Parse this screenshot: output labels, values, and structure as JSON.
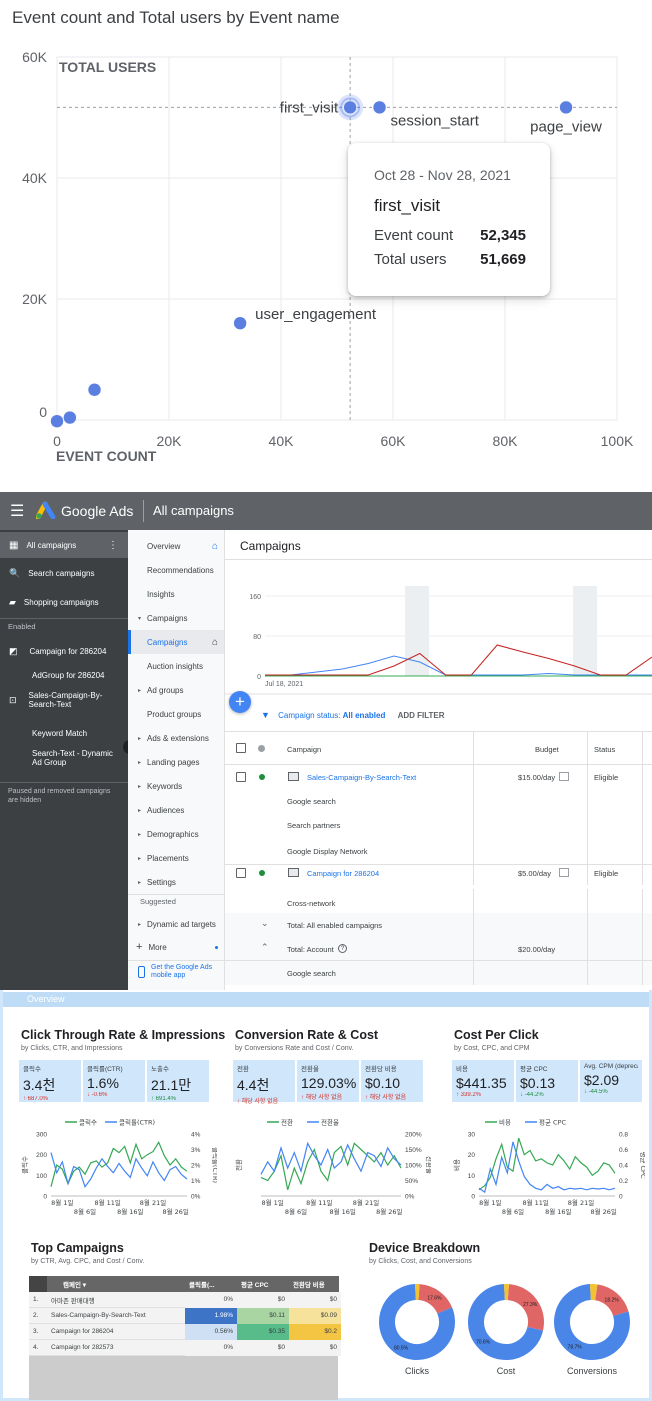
{
  "scatter": {
    "title": "Event count and Total users by Event name",
    "tooltip": {
      "date": "Oct 28 - Nov 28, 2021",
      "name": "first_visit",
      "event_count_label": "Event count",
      "event_count": "52,345",
      "total_users_label": "Total users",
      "total_users": "51,669"
    }
  },
  "chart_data": [
    {
      "type": "scatter",
      "title": "Event count and Total users by Event name",
      "xlabel": "EVENT COUNT",
      "ylabel": "TOTAL USERS",
      "xlim": [
        0,
        100000
      ],
      "ylim": [
        0,
        60000
      ],
      "x_ticks": [
        "0",
        "20K",
        "40K",
        "60K",
        "80K",
        "100K"
      ],
      "y_ticks": [
        "0",
        "20K",
        "40K",
        "60K"
      ],
      "points": [
        {
          "label": "first_visit",
          "x": 52345,
          "y": 51669
        },
        {
          "label": "session_start",
          "x": 57600,
          "y": 51669
        },
        {
          "label": "page_view",
          "x": 90900,
          "y": 51669
        },
        {
          "label": "user_engagement",
          "x": 32700,
          "y": 16000
        },
        {
          "label": "",
          "x": 6700,
          "y": 5000
        },
        {
          "label": "",
          "x": 2300,
          "y": 400
        },
        {
          "label": "",
          "x": 0,
          "y": -200
        }
      ],
      "grid": true
    },
    {
      "type": "line",
      "title": "",
      "y_ticks": [
        "0",
        "80",
        "160"
      ],
      "ylim": [
        0,
        160
      ],
      "x_start_label": "Jul 18, 2021",
      "series": [
        {
          "color": "#4285f4",
          "values": [
            2,
            2,
            8,
            14,
            25,
            40,
            28,
            2,
            2,
            2,
            2,
            5,
            2,
            2,
            2,
            2
          ]
        },
        {
          "color": "#c5221f",
          "values": [
            2,
            2,
            2,
            2,
            2,
            20,
            45,
            2,
            2,
            62,
            48,
            35,
            20,
            2,
            2,
            38
          ]
        },
        {
          "color": "#f9ab00",
          "values": [
            0,
            0,
            0,
            0,
            0,
            0,
            0,
            0,
            0,
            0,
            0,
            0,
            0,
            0,
            0,
            0
          ]
        },
        {
          "color": "#34a853",
          "values": [
            0,
            0,
            0,
            0,
            0,
            0,
            0,
            0,
            0,
            0,
            0,
            0,
            0,
            0,
            0,
            0
          ]
        }
      ]
    },
    {
      "type": "line",
      "title": "Click Through Rate & Impressions",
      "categories": [
        "8월 1일",
        "8월 6일",
        "8월 11일",
        "8월 16일",
        "8월 21일",
        "8월 26일"
      ],
      "left_ticks": [
        "0",
        "100",
        "200",
        "300"
      ],
      "right_ticks": [
        "0%",
        "1%",
        "2%",
        "3%",
        "4%"
      ],
      "ylabel_left": "클릭수",
      "ylabel_right": "클릭률(CTR)",
      "series": [
        {
          "name": "클릭수",
          "color": "#34a853",
          "values": [
            45,
            150,
            130,
            60,
            120,
            140,
            105,
            160,
            170,
            140,
            160,
            230,
            210,
            240,
            160,
            250,
            180,
            200,
            215,
            260,
            195,
            150,
            180,
            140,
            120
          ]
        },
        {
          "name": "클릭률(CTR)",
          "color": "#4285f4",
          "values": [
            2.8,
            1.5,
            2.2,
            0.8,
            1.9,
            1.7,
            0.6,
            1.1,
            1.8,
            2.4,
            1.9,
            1.5,
            2.1,
            1.6,
            1.2,
            2.4,
            1.8,
            1.3,
            2.2,
            1.5,
            1.0,
            1.7,
            1.9,
            1.4,
            1.1
          ]
        }
      ]
    },
    {
      "type": "line",
      "title": "Conversion Rate & Cost",
      "categories": [
        "8월 1일",
        "8월 6일",
        "8월 11일",
        "8월 16일",
        "8월 21일",
        "8월 26일"
      ],
      "right_ticks": [
        "0%",
        "50%",
        "100%",
        "150%",
        "200%"
      ],
      "ylabel_left": "전환",
      "ylabel_right": "전환율",
      "series": [
        {
          "name": "전환",
          "color": "#34a853",
          "values": [
            0.6,
            0.5,
            0.8,
            1.3,
            0.2,
            0.9,
            0.4,
            1.1,
            1.5,
            0.8,
            0.5,
            1.4,
            1.6,
            1.0,
            1.7,
            1.5,
            1.3,
            1.1,
            1.4,
            1.0,
            1.3,
            0.9
          ]
        },
        {
          "name": "전환율",
          "color": "#4285f4",
          "values": [
            70,
            110,
            80,
            155,
            90,
            140,
            80,
            170,
            130,
            100,
            150,
            90,
            110,
            165,
            120,
            80,
            140,
            130,
            95,
            155,
            120,
            100
          ]
        }
      ]
    },
    {
      "type": "line",
      "title": "Cost Per Click",
      "categories": [
        "8월 1일",
        "8월 6일",
        "8월 11일",
        "8월 16일",
        "8월 21일",
        "8월 26일"
      ],
      "left_ticks": [
        "0",
        "10",
        "20",
        "30"
      ],
      "right_ticks": [
        "0",
        "0.2",
        "0.4",
        "0.6",
        "0.8"
      ],
      "ylabel_left": "비용",
      "ylabel_right": "평균 CPC",
      "series": [
        {
          "name": "비용",
          "color": "#34a853",
          "values": [
            3,
            5,
            9,
            18,
            25,
            14,
            12,
            28,
            20,
            22,
            17,
            18,
            16,
            15,
            20,
            17,
            13,
            19,
            16,
            14,
            10,
            12,
            16,
            15,
            11
          ]
        },
        {
          "name": "평균 CPC",
          "color": "#4285f4",
          "values": [
            0.1,
            0.05,
            0.35,
            0.15,
            0.5,
            0.3,
            0.7,
            0.45,
            0.25,
            0.15,
            0.1,
            0.08,
            0.15,
            0.1,
            0.12,
            0.08,
            0.1,
            0.09,
            0.1,
            0.08,
            0.1,
            0.09,
            0.1,
            0.08,
            0.1
          ]
        }
      ]
    },
    {
      "type": "pie",
      "title": "Device Breakdown",
      "charts": [
        {
          "name": "Clicks",
          "slices": [
            {
              "value": 80.5,
              "color": "#4a86e8",
              "label": "80.5%"
            },
            {
              "value": 17.6,
              "color": "#e06666",
              "label": "17.6%"
            },
            {
              "value": 1.9,
              "color": "#f1c232",
              "label": ""
            }
          ]
        },
        {
          "name": "Cost",
          "slices": [
            {
              "value": 70.6,
              "color": "#4a86e8",
              "label": "70.6%"
            },
            {
              "value": 27.3,
              "color": "#e06666",
              "label": "27.3%"
            },
            {
              "value": 2.1,
              "color": "#f1c232",
              "label": ""
            }
          ]
        },
        {
          "name": "Conversions",
          "slices": [
            {
              "value": 78.7,
              "color": "#4a86e8",
              "label": "78.7%"
            },
            {
              "value": 18.2,
              "color": "#e06666",
              "label": "18.2%"
            },
            {
              "value": 3.1,
              "color": "#f1c232",
              "label": ""
            }
          ]
        }
      ]
    }
  ],
  "ads": {
    "brand": "Google Ads",
    "title": "All campaigns",
    "leftnav": [
      {
        "label": "All campaigns"
      },
      {
        "label": "Search campaigns"
      },
      {
        "label": "Shopping campaigns"
      },
      {
        "label": "Enabled"
      },
      {
        "label": "Campaign for 286204"
      },
      {
        "label": "AdGroup for 286204"
      },
      {
        "label": "Sales-Campaign-By-Search-Text"
      },
      {
        "label": "Keyword Match"
      },
      {
        "label": "Search-Text - Dynamic Ad Group"
      },
      {
        "label": "Paused and removed campaigns are hidden"
      }
    ],
    "midnav": [
      "Overview",
      "Recommendations",
      "Insights",
      "Campaigns",
      "Campaigns",
      "Auction insights",
      "Ad groups",
      "Product groups",
      "Ads & extensions",
      "Landing pages",
      "Keywords",
      "Audiences",
      "Demographics",
      "Placements",
      "Settings",
      "Suggested",
      "Dynamic ad targets",
      "More",
      "Get the Google Ads mobile app"
    ],
    "page_title": "Campaigns",
    "filter_label": "Campaign status:",
    "filter_value": "All enabled",
    "add_filter": "ADD FILTER",
    "columns": {
      "campaign": "Campaign",
      "budget": "Budget",
      "status": "Status"
    },
    "rows": [
      {
        "name": "Sales-Campaign-By-Search-Text",
        "budget": "$15.00/day",
        "status": "Eligible"
      },
      {
        "name": "Google search"
      },
      {
        "name": "Search partners"
      },
      {
        "name": "Google Display Network"
      },
      {
        "name": "Campaign for 286204",
        "budget": "$5.00/day",
        "status": "Eligible"
      },
      {
        "name": "Cross-network"
      },
      {
        "name": "Total: All enabled campaigns"
      },
      {
        "name": "Total: Account",
        "budget": "$20.00/day"
      },
      {
        "name": "Google search"
      }
    ]
  },
  "dash": {
    "overview": "Overview",
    "p1": {
      "title": "Click Through Rate & Impressions",
      "sub": "by Clicks, CTR, and Impressions",
      "kpis": [
        {
          "label": "클릭수",
          "value": "3.4천",
          "delta": "↑ 687.0%",
          "cls": "red"
        },
        {
          "label": "클릭률(CTR)",
          "value": "1.6%",
          "delta": "↓ -0.6%",
          "cls": "red"
        },
        {
          "label": "노출수",
          "value": "21.1만",
          "delta": "↑ 691.4%",
          "cls": "grn"
        }
      ]
    },
    "p2": {
      "title": "Conversion Rate & Cost",
      "sub": "by Conversions Rate and Cost / Conv.",
      "kpis": [
        {
          "label": "전환",
          "value": "4.4천",
          "delta": "↑ 해당 사항 없음",
          "cls": "red"
        },
        {
          "label": "전환율",
          "value": "129.03%",
          "delta": "↑ 해당 사항 없음",
          "cls": "red"
        },
        {
          "label": "전환당 비용",
          "value": "$0.10",
          "delta": "↑ 해당 사항 없음",
          "cls": "red"
        }
      ]
    },
    "p3": {
      "title": "Cost Per Click",
      "sub": "by Cost, CPC, and CPM",
      "kpis": [
        {
          "label": "비용",
          "value": "$441.35",
          "delta": "↑ 339.2%",
          "cls": "red"
        },
        {
          "label": "평균 CPC",
          "value": "$0.13",
          "delta": "↓ -44.2%",
          "cls": "grn"
        },
        {
          "label": "Avg. CPM (deprecated)",
          "value": "$2.09",
          "delta": "↓ -44.5%",
          "cls": "grn"
        }
      ]
    },
    "top": {
      "title": "Top Campaigns",
      "sub": "by CTR, Avg. CPC, and Cost / Conv.",
      "head": [
        "캠페인 ▾",
        "클릭률(...",
        "평균 CPC",
        "전환당 비용"
      ],
      "rows": [
        [
          "1.",
          "아마존 판매대행",
          "0%",
          "$0",
          "$0"
        ],
        [
          "2.",
          "Sales-Campaign-By-Search-Text",
          "1.98%",
          "$0.11",
          "$0.09"
        ],
        [
          "3.",
          "Campaign for 286204",
          "0.56%",
          "$0.35",
          "$0.2"
        ],
        [
          "4.",
          "Campaign for 282573",
          "0%",
          "$0",
          "$0"
        ]
      ]
    },
    "device": {
      "title": "Device Breakdown",
      "sub": "by Clicks, Cost, and Conversions"
    }
  }
}
